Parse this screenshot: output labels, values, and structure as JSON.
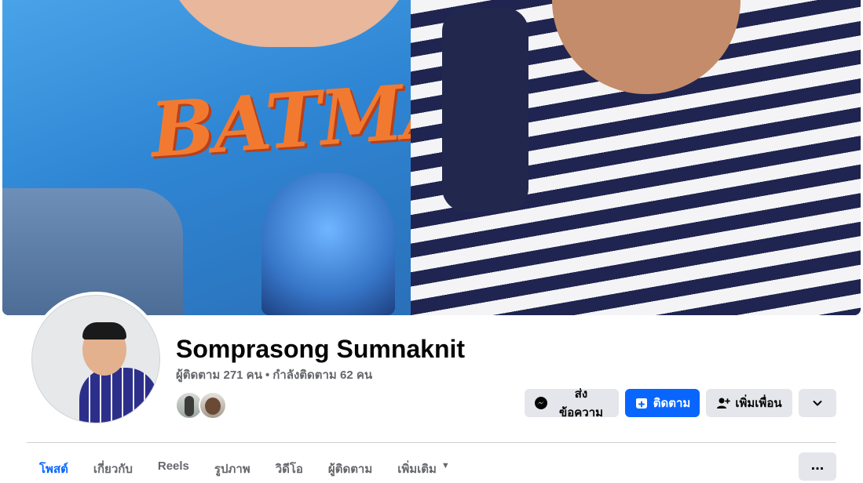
{
  "profile": {
    "name": "Somprasong Sumnaknit",
    "followers_text": "ผู้ติดตาม 271 คน",
    "separator": "•",
    "following_text": "กำลังติดตาม 62 คน"
  },
  "actions": {
    "message_label": "ส่งข้อความ",
    "follow_label": "ติดตาม",
    "add_friend_label": "เพิ่มเพื่อน"
  },
  "tabs": [
    {
      "label": "โพสต์",
      "active": true
    },
    {
      "label": "เกี่ยวกับ"
    },
    {
      "label": "Reels"
    },
    {
      "label": "รูปภาพ"
    },
    {
      "label": "วิดีโอ"
    },
    {
      "label": "ผู้ติดตาม"
    },
    {
      "label": "เพิ่มเติม"
    }
  ],
  "tabs_menu_label": "...",
  "colors": {
    "primary_blue": "#0866ff",
    "secondary_button": "#e4e6eb",
    "muted_text": "#65676b"
  },
  "icons": {
    "message": "messenger-icon",
    "follow": "follow-icon",
    "add_friend": "add-friend-icon",
    "more": "chevron-down-icon",
    "tab_more": "caret-down-icon",
    "tabs_menu": "ellipsis-icon"
  }
}
